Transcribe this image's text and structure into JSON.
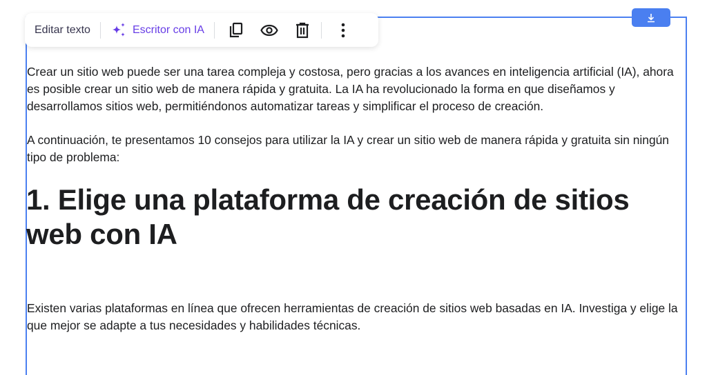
{
  "toolbar": {
    "edit_text": "Editar texto",
    "ai_writer": "Escritor con IA",
    "icons": [
      "sparkle-icon",
      "copy-icon",
      "eye-icon",
      "trash-icon",
      "more-vertical-icon"
    ]
  },
  "download_icon": "download-icon",
  "colors": {
    "accent": "#4a7ff0",
    "ai": "#673de6",
    "text": "#1d1e20"
  },
  "content": {
    "p1": "Crear un sitio web puede ser una tarea compleja y costosa, pero gracias a los avances en inteligencia artificial (IA), ahora es posible crear un sitio web de manera rápida y gratuita. La IA ha revolucionado la forma en que diseñamos y desarrollamos sitios web, permitiéndonos automatizar tareas y simplificar el proceso de creación.",
    "p2": "A continuación, te presentamos 10 consejos para utilizar la IA y crear un sitio web de manera rápida y gratuita sin ningún tipo de problema:",
    "h1": "1. Elige una plataforma de creación de sitios web con IA",
    "p3": "Existen varias plataformas en línea que ofrecen herramientas de creación de sitios web basadas en IA. Investiga y elige la que mejor se adapte a tus necesidades y habilidades técnicas."
  }
}
